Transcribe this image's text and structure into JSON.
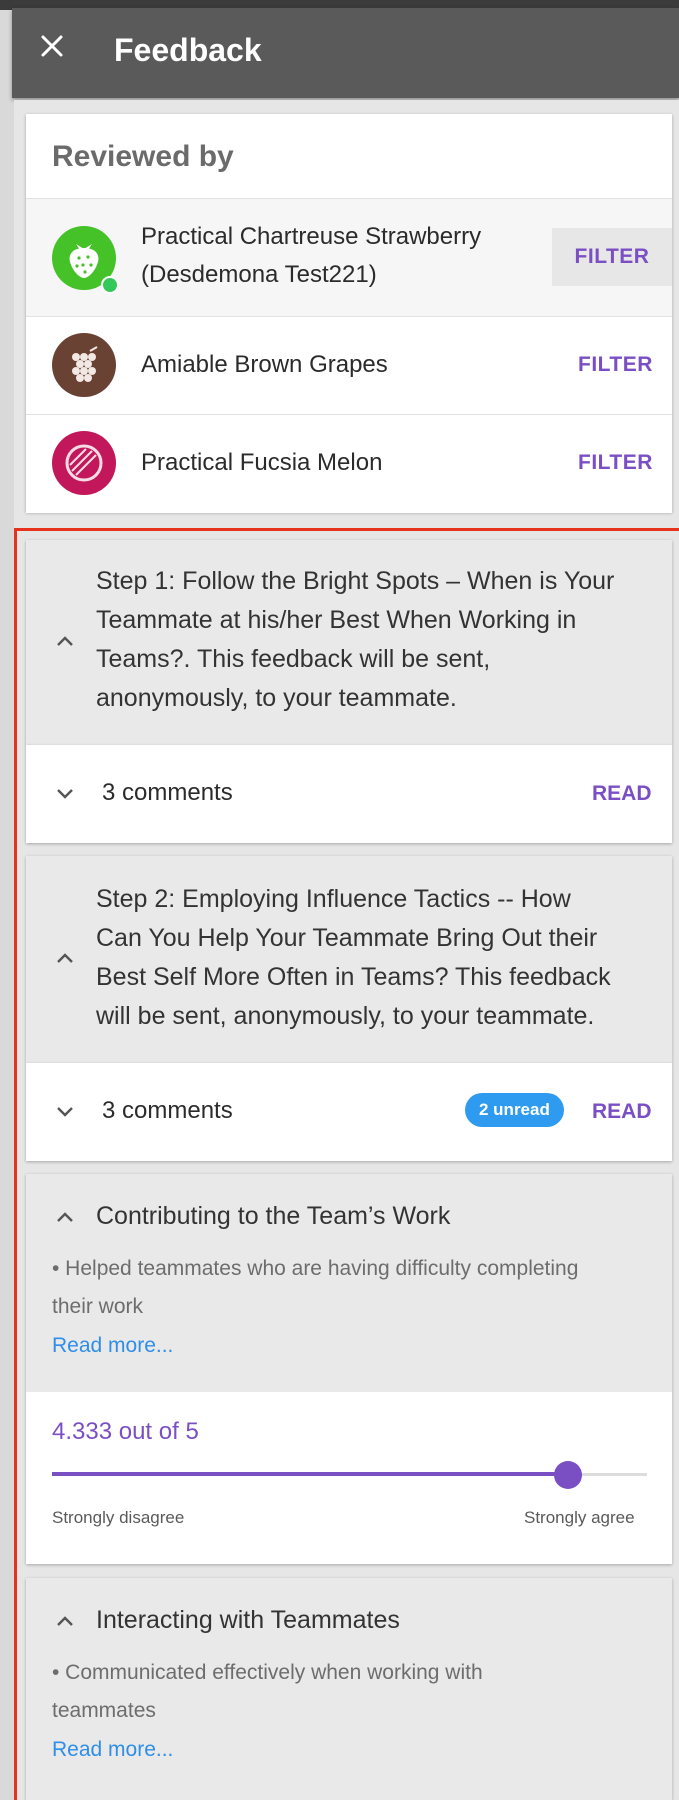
{
  "header": {
    "title": "Feedback"
  },
  "reviewers": {
    "title": "Reviewed by",
    "items": [
      {
        "name_line1": "Practical Chartreuse Strawberry",
        "name_line2": "(Desdemona Test221)",
        "avatar_icon": "strawberry-icon",
        "avatar_color": "#44c227",
        "online": true,
        "filter_label": "FILTER"
      },
      {
        "name_line1": "Amiable Brown Grapes",
        "avatar_icon": "grapes-icon",
        "avatar_color": "#6a4233",
        "filter_label": "FILTER"
      },
      {
        "name_line1": "Practical Fucsia Melon",
        "avatar_icon": "melon-icon",
        "avatar_color": "#c2185b",
        "filter_label": "FILTER"
      }
    ]
  },
  "steps": [
    {
      "lines": [
        "Step 1: Follow the Bright Spots – When is Your",
        "Teammate at his/her Best When Working in",
        "Teams?. This feedback will be sent,",
        "anonymously, to your teammate."
      ],
      "comments_label": "3 comments",
      "read_label": "READ"
    },
    {
      "lines": [
        "Step 2: Employing Influence Tactics -- How",
        "Can You Help Your Teammate Bring Out their",
        "Best Self More Often in Teams? This feedback",
        "will be sent, anonymously, to your teammate."
      ],
      "comments_label": "3 comments",
      "unread_label": "2 unread",
      "read_label": "READ"
    }
  ],
  "ratings": [
    {
      "title": "Contributing to the Team’s Work",
      "bullet_lines": [
        "• Helped teammates who are having difficulty completing",
        "their work"
      ],
      "read_more": "Read more...",
      "score_text": "4.333 out of 5",
      "score_value": 4.333,
      "score_max": 5,
      "min_label": "Strongly disagree",
      "max_label": "Strongly agree"
    },
    {
      "title": "Interacting with Teammates",
      "bullet_lines": [
        "• Communicated effectively when working with",
        "teammates"
      ],
      "read_more": "Read more..."
    }
  ],
  "colors": {
    "accent": "#7b4fc4",
    "link": "#2f8ee8",
    "badge": "#2f9bf0",
    "highlight_border": "#e8331c"
  }
}
